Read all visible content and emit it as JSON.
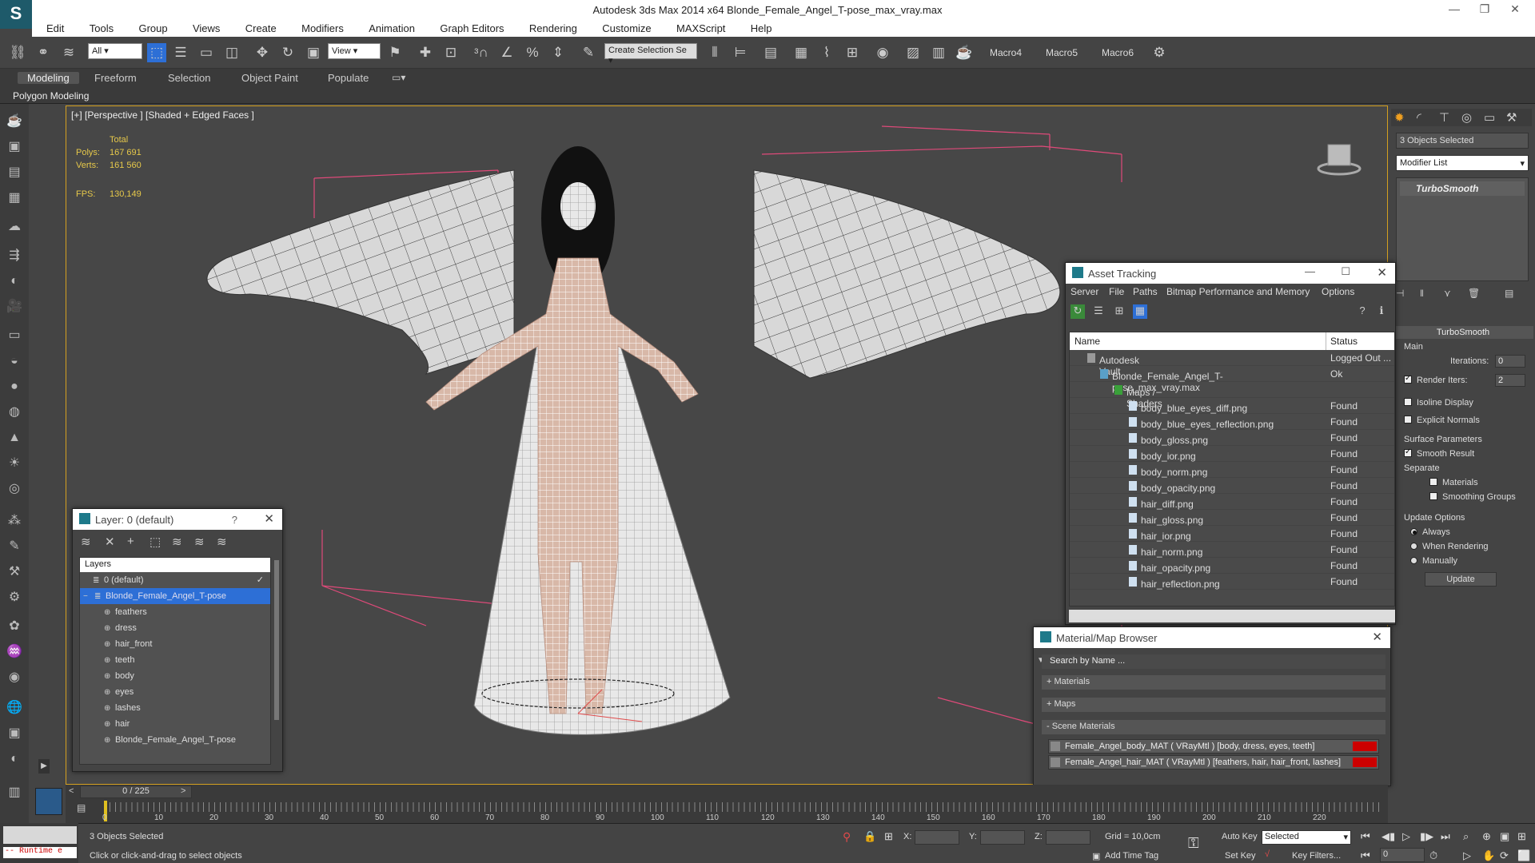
{
  "app": {
    "title": "Autodesk 3ds Max  2014 x64    Blonde_Female_Angel_T-pose_max_vray.max",
    "logo": "S"
  },
  "menu": [
    "Edit",
    "Tools",
    "Group",
    "Views",
    "Create",
    "Modifiers",
    "Animation",
    "Graph Editors",
    "Rendering",
    "Customize",
    "MAXScript",
    "Help"
  ],
  "toolbar": {
    "filter": "All",
    "ref_coord": "View",
    "selection_set": "Create Selection Se",
    "macro4": "Macro4",
    "macro5": "Macro5",
    "macro6": "Macro6"
  },
  "ribbon": {
    "tabs": [
      "Modeling",
      "Freeform",
      "Selection",
      "Object Paint",
      "Populate"
    ],
    "panel": "Polygon Modeling"
  },
  "viewport": {
    "label": "[+] [Perspective ] [Shaded + Edged Faces ]",
    "total_label": "Total",
    "polys_label": "Polys:",
    "polys": "167 691",
    "verts_label": "Verts:",
    "verts": "161 560",
    "fps_label": "FPS:",
    "fps": "130,149"
  },
  "command_panel": {
    "selection": "3 Objects Selected",
    "modifier_list": "Modifier List",
    "stack_item": "TurboSmooth",
    "rollout": "TurboSmooth",
    "main": "Main",
    "iterations_label": "Iterations:",
    "iterations": "0",
    "render_iters_label": "Render Iters:",
    "render_iters": "2",
    "isoline": "Isoline Display",
    "explicit_normals": "Explicit Normals",
    "surface_params": "Surface Parameters",
    "smooth_result": "Smooth Result",
    "separate": "Separate",
    "materials": "Materials",
    "smoothing_groups": "Smoothing Groups",
    "update_options": "Update Options",
    "always": "Always",
    "when_rendering": "When Rendering",
    "manually": "Manually",
    "update_btn": "Update"
  },
  "layer_dialog": {
    "title": "Layer: 0 (default)",
    "help": "?",
    "header": "Layers",
    "rows": [
      {
        "name": "0 (default)",
        "level": 0,
        "selected": false
      },
      {
        "name": "Blonde_Female_Angel_T-pose",
        "level": 0,
        "selected": true
      },
      {
        "name": "feathers",
        "level": 1,
        "selected": false
      },
      {
        "name": "dress",
        "level": 1,
        "selected": false
      },
      {
        "name": "hair_front",
        "level": 1,
        "selected": false
      },
      {
        "name": "teeth",
        "level": 1,
        "selected": false
      },
      {
        "name": "body",
        "level": 1,
        "selected": false
      },
      {
        "name": "eyes",
        "level": 1,
        "selected": false
      },
      {
        "name": "lashes",
        "level": 1,
        "selected": false
      },
      {
        "name": "hair",
        "level": 1,
        "selected": false
      },
      {
        "name": "Blonde_Female_Angel_T-pose",
        "level": 1,
        "selected": false
      }
    ]
  },
  "asset_dialog": {
    "title": "Asset Tracking",
    "menu": [
      "Server",
      "File",
      "Paths",
      "Bitmap Performance and Memory",
      "Options"
    ],
    "col_name": "Name",
    "col_status": "Status",
    "rows": [
      {
        "name": "Autodesk Vault",
        "status": "Logged Out ...",
        "indent": 1
      },
      {
        "name": "Blonde_Female_Angel_T-pose_max_vray.max",
        "status": "Ok",
        "indent": 2
      },
      {
        "name": "Maps / Shaders",
        "status": "",
        "indent": 3
      },
      {
        "name": "body_blue_eyes_diff.png",
        "status": "Found",
        "indent": 4
      },
      {
        "name": "body_blue_eyes_reflection.png",
        "status": "Found",
        "indent": 4
      },
      {
        "name": "body_gloss.png",
        "status": "Found",
        "indent": 4
      },
      {
        "name": "body_ior.png",
        "status": "Found",
        "indent": 4
      },
      {
        "name": "body_norm.png",
        "status": "Found",
        "indent": 4
      },
      {
        "name": "body_opacity.png",
        "status": "Found",
        "indent": 4
      },
      {
        "name": "hair_diff.png",
        "status": "Found",
        "indent": 4
      },
      {
        "name": "hair_gloss.png",
        "status": "Found",
        "indent": 4
      },
      {
        "name": "hair_ior.png",
        "status": "Found",
        "indent": 4
      },
      {
        "name": "hair_norm.png",
        "status": "Found",
        "indent": 4
      },
      {
        "name": "hair_opacity.png",
        "status": "Found",
        "indent": 4
      },
      {
        "name": "hair_reflection.png",
        "status": "Found",
        "indent": 4
      }
    ]
  },
  "mat_browser": {
    "title": "Material/Map Browser",
    "search": "Search by Name ...",
    "materials": "+ Materials",
    "maps": "+ Maps",
    "scene_materials": "- Scene Materials",
    "items": [
      "Female_Angel_body_MAT  ( VRayMtl )  [body, dress, eyes, teeth]",
      "Female_Angel_hair_MAT  ( VRayMtl )  [feathers, hair, hair_front, lashes]"
    ]
  },
  "timeline": {
    "frame": "0 / 225",
    "ticks": [
      "0",
      "10",
      "20",
      "30",
      "40",
      "50",
      "60",
      "70",
      "80",
      "90",
      "100",
      "110",
      "120",
      "130",
      "140",
      "150",
      "160",
      "170",
      "180",
      "190",
      "200",
      "210",
      "220"
    ]
  },
  "status": {
    "runtime": "-- Runtime e",
    "selected": "3 Objects Selected",
    "prompt": "Click or click-and-drag to select objects",
    "x": "X:",
    "y": "Y:",
    "z": "Z:",
    "grid": "Grid = 10,0cm",
    "auto_key": "Auto Key",
    "key_mode": "Selected",
    "set_key": "Set Key",
    "key_filters": "Key Filters...",
    "add_time_tag": "Add Time Tag",
    "frame_field": "0"
  },
  "colors": {
    "accent": "#2d6fd6",
    "viewport_border": "#d4a020",
    "stats": "#e6c84a",
    "material_swatch": "#cc0000"
  }
}
